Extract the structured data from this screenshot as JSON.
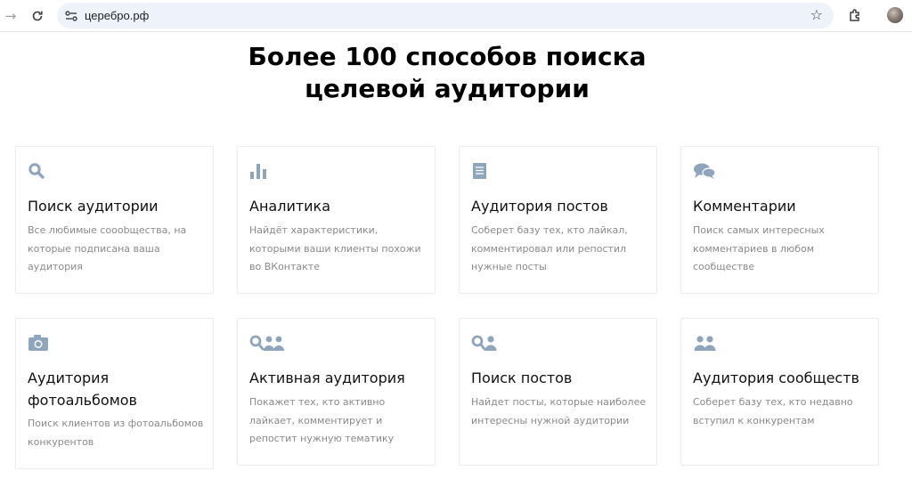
{
  "browser": {
    "url": "церебро.рф",
    "icons": {
      "forward": "arrow-forward-icon",
      "reload": "reload-icon",
      "site_info": "site-info-icon",
      "bookmark": "star-icon",
      "extensions": "extensions-icon",
      "profile": "avatar"
    }
  },
  "page": {
    "heading_line1": "Более 100 способов поиска",
    "heading_line2": "целевой аудитории",
    "cards": [
      {
        "icon": "search-icon",
        "title": "Поиск аудитории",
        "desc": "Все любимые сооobщества, на которые подписана ваша аудитория"
      },
      {
        "icon": "bar-chart-icon",
        "title": "Аналитика",
        "desc": "Найдёт характеристики, которыми ваши клиенты похожи во ВКонтакте"
      },
      {
        "icon": "document-icon",
        "title": "Аудитория постов",
        "desc": "Соберет базу тех, кто лайкал, комментировал или репостил нужные посты"
      },
      {
        "icon": "comments-icon",
        "title": "Комментарии",
        "desc": "Поиск самых интересных комментариев в любом сообществе"
      },
      {
        "icon": "camera-icon",
        "title": "Аудитория фотоальбомов",
        "desc": "Поиск клиентов из фотоальбомов конкурентов"
      },
      {
        "icon": "search-users-icon",
        "title": "Активная аудитория",
        "desc": "Покажет тех, кто активно лайкает, комментирует и репостит нужную тематику"
      },
      {
        "icon": "user-search-icon",
        "title": "Поиск постов",
        "desc": "Найдет посты, которые наиболее интересны нужной аудитории"
      },
      {
        "icon": "users-icon",
        "title": "Аудитория сообществ",
        "desc": "Соберет базу тех, кто недавно вступил к конкурентам"
      }
    ]
  },
  "colors": {
    "icon": "#8fa5bb",
    "desc_text": "#8a8a8a",
    "card_border": "#ececec",
    "omnibox": "#eef2fa"
  }
}
